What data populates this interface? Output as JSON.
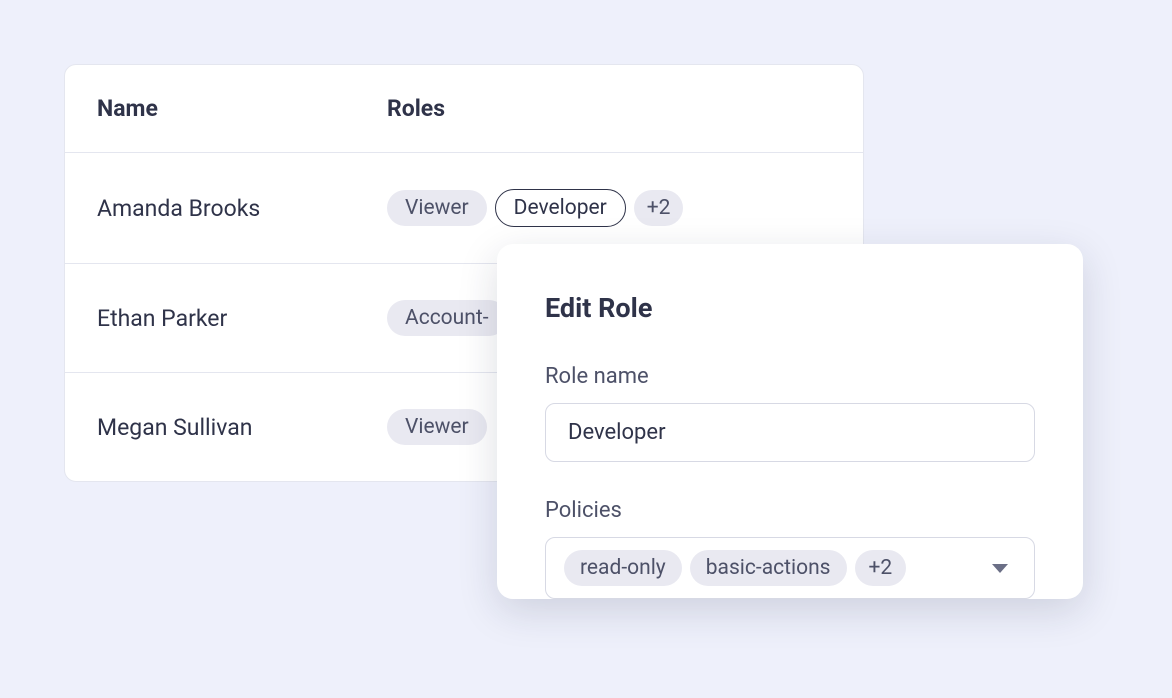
{
  "table": {
    "headers": {
      "name": "Name",
      "roles": "Roles"
    },
    "rows": [
      {
        "name": "Amanda Brooks",
        "roles": [
          "Viewer",
          "Developer"
        ],
        "selected_role_index": 1,
        "more_count": "+2"
      },
      {
        "name": "Ethan Parker",
        "roles": [
          "Account-"
        ],
        "selected_role_index": -1,
        "more_count": null
      },
      {
        "name": "Megan Sullivan",
        "roles": [
          "Viewer"
        ],
        "selected_role_index": -1,
        "more_count": null
      }
    ]
  },
  "modal": {
    "title": "Edit Role",
    "role_name_label": "Role name",
    "role_name_value": "Developer",
    "policies_label": "Policies",
    "policies": [
      "read-only",
      "basic-actions"
    ],
    "policies_more_count": "+2"
  }
}
